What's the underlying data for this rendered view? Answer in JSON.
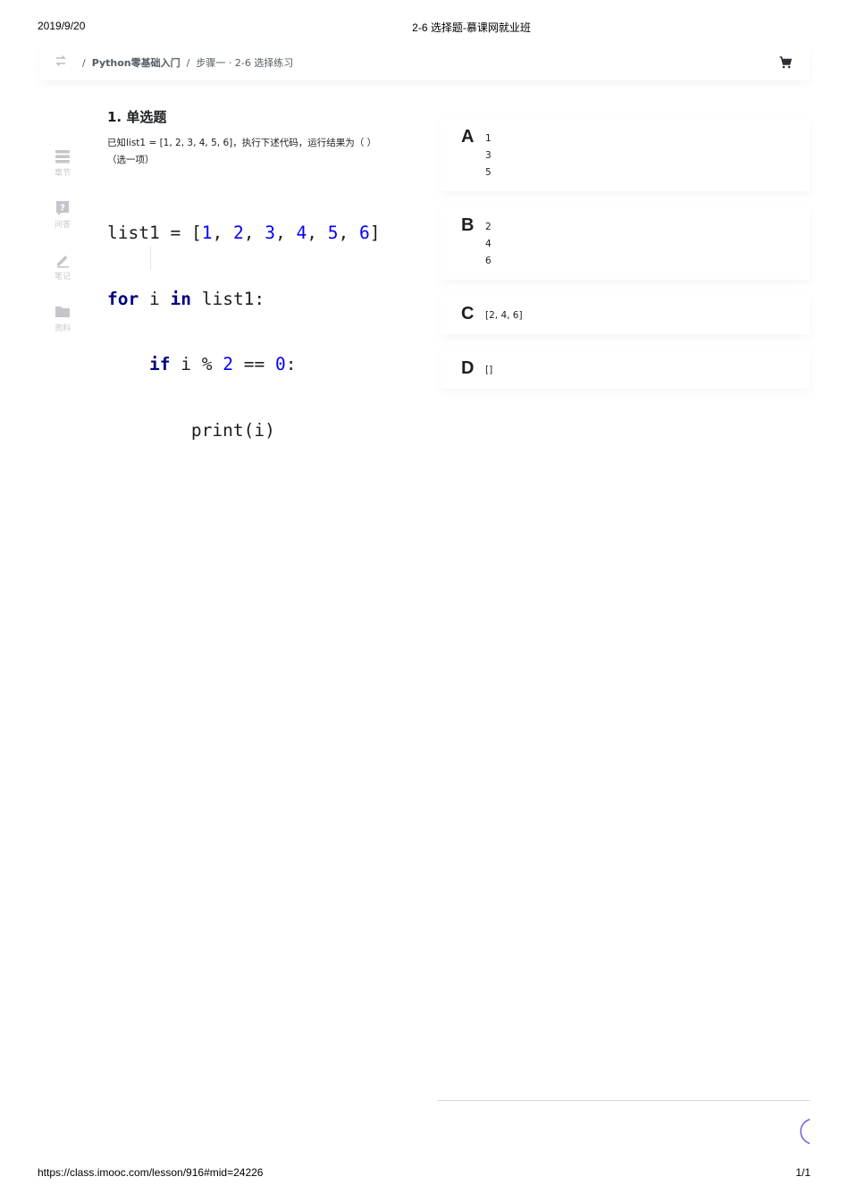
{
  "print_header": {
    "date": "2019/9/20",
    "title": "2-6 选择题-慕课网就业班"
  },
  "print_footer": {
    "url": "https://class.imooc.com/lesson/916#mid=24226",
    "page": "1/1"
  },
  "breadcrumb": {
    "separator": "/",
    "course": "Python零基础入门",
    "lesson": "步骤一 · 2-6 选择练习"
  },
  "sidebar": {
    "items": [
      {
        "label": "章节",
        "icon": "chapter-icon"
      },
      {
        "label": "问答",
        "icon": "question-icon"
      },
      {
        "label": "笔记",
        "icon": "pencil-icon"
      },
      {
        "label": "资料",
        "icon": "folder-icon"
      }
    ]
  },
  "question": {
    "title": "1. 单选题",
    "text_line1": "已知list1 = [1, 2, 3, 4, 5, 6]，执行下述代码，运行结果为（ ）",
    "text_line2": "（选一项）",
    "code_lines": [
      "list1 = [1, 2, 3, 4, 5, 6]",
      "for i in list1:",
      "    if i % 2 == 0:",
      "        print(i)"
    ]
  },
  "options": [
    {
      "letter": "A",
      "values": [
        "1",
        "3",
        "5"
      ]
    },
    {
      "letter": "B",
      "values": [
        "2",
        "4",
        "6"
      ]
    },
    {
      "letter": "C",
      "values": [
        "[2, 4, 6]"
      ]
    },
    {
      "letter": "D",
      "values": [
        "[]"
      ]
    }
  ],
  "colors": {
    "accent": "#7b5fd6",
    "icon_gray": "#c3c6ca",
    "text": "#1c1f21"
  }
}
